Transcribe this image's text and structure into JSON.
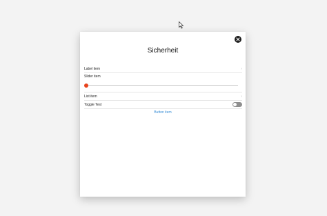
{
  "dialog": {
    "title": "Sicherheit",
    "close_icon": "close-icon"
  },
  "rows": {
    "label_item": "Label item",
    "slider_label": "Slider item",
    "list_item": "List item",
    "toggle_label": "Toggle Test",
    "button_label": "Button item"
  },
  "slider": {
    "value_fraction": 0.0
  },
  "toggle": {
    "on": false
  },
  "colors": {
    "slider_accent": "#e8431d",
    "link": "#3b8fd6",
    "toggle_off": "#8f8f8f"
  }
}
